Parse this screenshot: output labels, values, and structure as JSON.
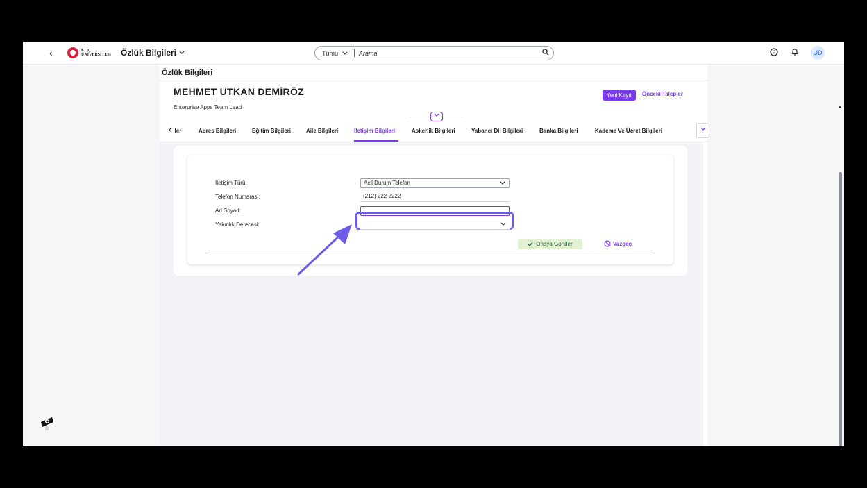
{
  "topbar": {
    "back_label": "‹",
    "logo_line1": "KOÇ",
    "logo_line2": "ÜNİVERSİTESİ",
    "app_title": "Özlük Bilgileri",
    "search_scope": "Tümü",
    "search_placeholder": "Arama",
    "user_initials": "UD",
    "icons": [
      "help-icon",
      "bell-icon"
    ]
  },
  "page": {
    "breadcrumb": "Özlük Bilgileri",
    "person_name": "MEHMET UTKAN DEMİRÖZ",
    "person_title": "Enterprise Apps Team Lead",
    "new_record_label": "Yeni Kayıt",
    "previous_requests_label": "Önceki Talepler"
  },
  "tabs": {
    "prev_partial": "ler",
    "items": [
      {
        "label": "Adres Bilgileri"
      },
      {
        "label": "Eğitim Bilgileri"
      },
      {
        "label": "Aile Bilgileri"
      },
      {
        "label": "İletişim Bilgileri",
        "active": true
      },
      {
        "label": "Askerlik Bilgileri"
      },
      {
        "label": "Yabancı Dil Bilgileri"
      },
      {
        "label": "Banka Bilgileri"
      },
      {
        "label": "Kademe Ve Ücret Bilgileri"
      }
    ]
  },
  "form": {
    "fields": [
      {
        "label": "İletişim Türü:",
        "value": "Acil Durum Telefon",
        "type": "select"
      },
      {
        "label": "Telefon Numarası:",
        "value": "(212) 222 2222",
        "type": "text"
      },
      {
        "label": "Ad Soyad:",
        "value": "",
        "type": "input",
        "focused": true
      },
      {
        "label": "Yakınlık Derecesi:",
        "value": "",
        "type": "select"
      }
    ],
    "submit_label": "Onaya Gönder",
    "cancel_label": "Vazgeç"
  },
  "colors": {
    "accent": "#7c3aed",
    "highlight": "#6d5ce8",
    "submit_bg": "#e2f0d3"
  }
}
